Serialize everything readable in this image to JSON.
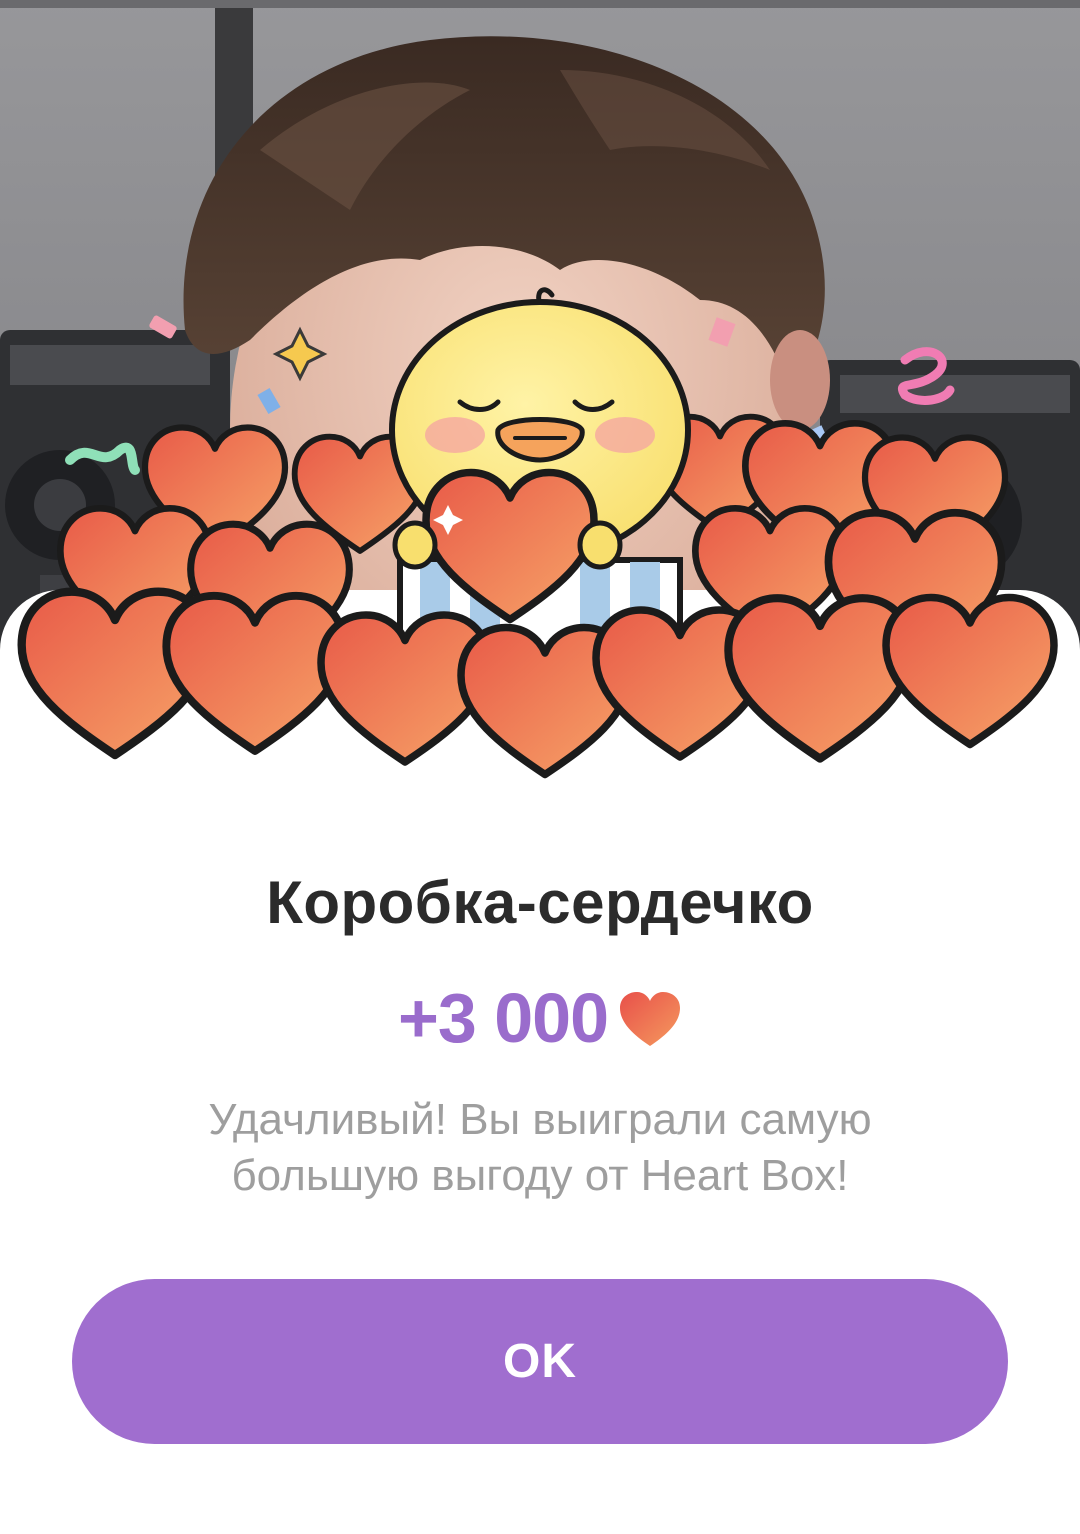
{
  "dialog": {
    "title": "Коробка-сердечко",
    "reward_amount": "+3 000",
    "reward_icon": "heart-icon",
    "message": "Удачливый! Вы выиграли самую большую выгоду от Heart Box!",
    "ok_label": "OK"
  },
  "colors": {
    "accent": "#a06ecf",
    "reward_text": "#9a6ccc",
    "title_text": "#2b2b2b",
    "message_text": "#9e9e9e",
    "heart_light": "#f5a268",
    "heart_dark": "#e85a48"
  }
}
